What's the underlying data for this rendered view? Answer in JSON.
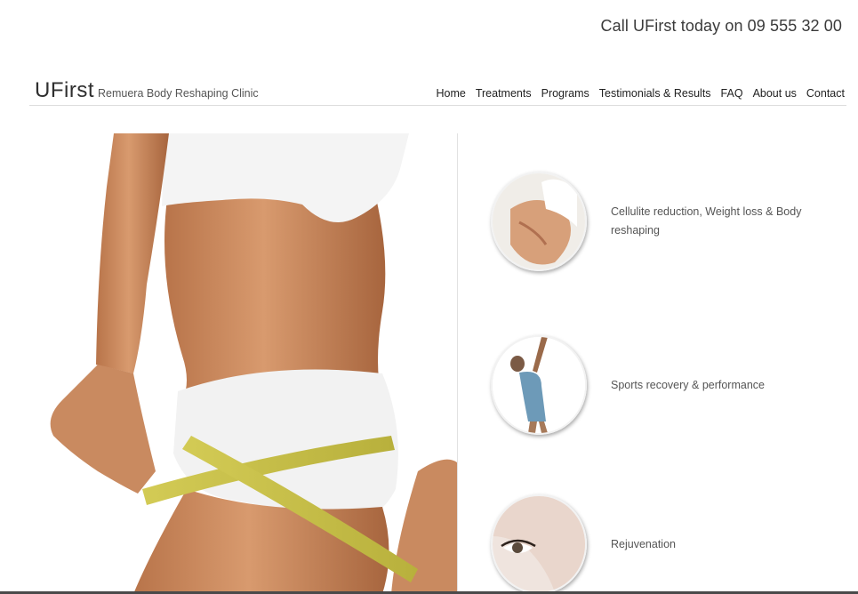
{
  "callbar": {
    "text": "Call UFirst today on 09 555 32 00"
  },
  "header": {
    "logo": "UFirst",
    "tagline": "Remuera Body Reshaping Clinic"
  },
  "nav": {
    "items": [
      "Home",
      "Treatments",
      "Programs",
      "Testimonials & Results",
      "FAQ",
      "About us",
      "Contact"
    ]
  },
  "features": [
    {
      "label": "Cellulite reduction, Weight loss & Body reshaping",
      "icon": "cellulite-thumbnail"
    },
    {
      "label": "Sports recovery & performance",
      "icon": "sports-thumbnail"
    },
    {
      "label": "Rejuvenation",
      "icon": "rejuvenation-thumbnail"
    }
  ],
  "colors": {
    "text": "#333333",
    "divider": "#dcdcdc",
    "skin": "#c8865c",
    "tape": "#c9c24a"
  }
}
